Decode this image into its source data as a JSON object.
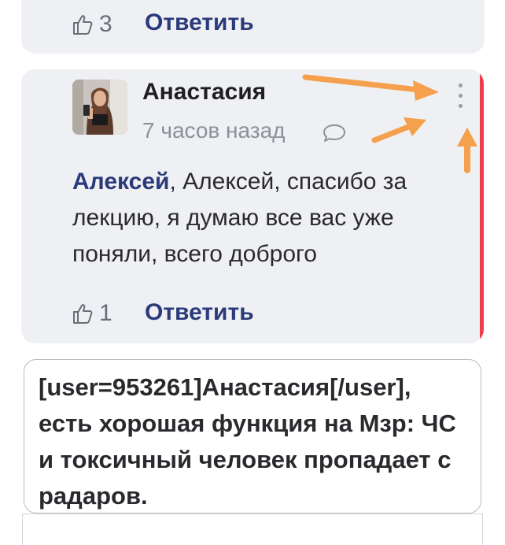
{
  "previous_comment": {
    "like_count": "3",
    "reply_label": "Ответить"
  },
  "comment": {
    "author": "Анастасия",
    "time": "7 часов назад",
    "mention": "Алексей",
    "text": ", Алексей, спасибо за лекцию, я думаю все вас уже поняли, всего доброго",
    "like_count": "1",
    "reply_label": "Ответить"
  },
  "reply_input": {
    "value": "[user=953261]Анастасия[/user], есть хорошая функция на Мзр: ЧС и токсичный человек пропадает с радаров."
  },
  "colors": {
    "annotation_arrow": "#f5a04c",
    "highlight_bar": "#ee3e4a",
    "link": "#2b3a7a"
  },
  "icons": {
    "like": "thumbs-up-icon",
    "comment": "speech-bubble-icon",
    "menu": "kebab-menu-icon"
  }
}
